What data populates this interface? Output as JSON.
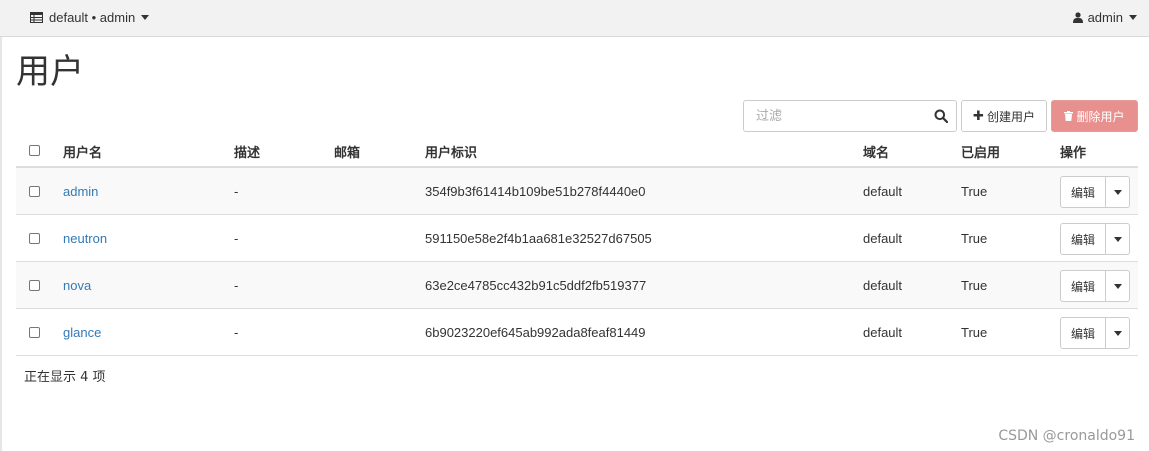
{
  "topbar": {
    "project_label": "default • admin",
    "user_label": "admin",
    "project_icon": "table-icon",
    "user_icon": "user-icon"
  },
  "page": {
    "title": "用户"
  },
  "toolbar": {
    "filter_placeholder": "过滤",
    "create_label": "创建用户",
    "delete_label": "删除用户",
    "delete_color": "#e8908e"
  },
  "table": {
    "headers": {
      "username": "用户名",
      "description": "描述",
      "email": "邮箱",
      "user_id": "用户标识",
      "domain": "域名",
      "enabled": "已启用",
      "actions": "操作"
    },
    "rows": [
      {
        "username": "admin",
        "description": "-",
        "email": "",
        "user_id": "354f9b3f61414b109be51b278f4440e0",
        "domain": "default",
        "enabled": "True",
        "action": "编辑"
      },
      {
        "username": "neutron",
        "description": "-",
        "email": "",
        "user_id": "591150e58e2f4b1aa681e32527d67505",
        "domain": "default",
        "enabled": "True",
        "action": "编辑"
      },
      {
        "username": "nova",
        "description": "-",
        "email": "",
        "user_id": "63e2ce4785cc432b91c5ddf2fb519377",
        "domain": "default",
        "enabled": "True",
        "action": "编辑"
      },
      {
        "username": "glance",
        "description": "-",
        "email": "",
        "user_id": "6b9023220ef645ab992ada8feaf81449",
        "domain": "default",
        "enabled": "True",
        "action": "编辑"
      }
    ]
  },
  "footer": {
    "count_text": "正在显示 4 项"
  },
  "watermark": "CSDN @cronaldo91",
  "colors": {
    "link": "#337ab7",
    "topbar_bg": "#f2f2f2"
  }
}
